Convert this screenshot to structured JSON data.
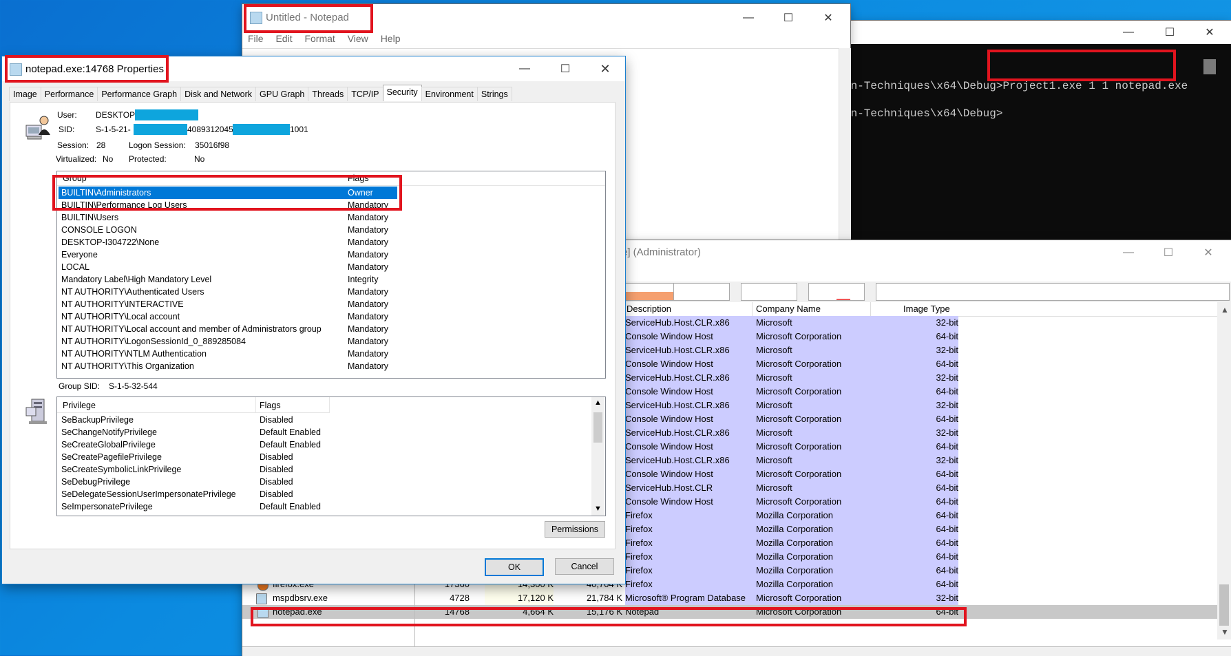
{
  "notepad": {
    "title": "Untitled - Notepad",
    "menu": [
      "File",
      "Edit",
      "Format",
      "View",
      "Help"
    ]
  },
  "console": {
    "line1_prefix": "on-Techniques\\x64\\Debug>",
    "line1_cmd": "Project1.exe 1 1 notepad.exe",
    "line2": "on-Techniques\\x64\\Debug>"
  },
  "procexp": {
    "title": "e] (Administrator)",
    "columns": {
      "description": "Description",
      "company": "Company Name",
      "image_type": "Image Type"
    },
    "rows": [
      {
        "desc": "ServiceHub.Host.CLR.x86",
        "company": "Microsoft",
        "type": "32-bit"
      },
      {
        "desc": "Console Window Host",
        "company": "Microsoft Corporation",
        "type": "64-bit"
      },
      {
        "desc": "ServiceHub.Host.CLR.x86",
        "company": "Microsoft",
        "type": "32-bit"
      },
      {
        "desc": "Console Window Host",
        "company": "Microsoft Corporation",
        "type": "64-bit"
      },
      {
        "desc": "ServiceHub.Host.CLR.x86",
        "company": "Microsoft",
        "type": "32-bit"
      },
      {
        "desc": "Console Window Host",
        "company": "Microsoft Corporation",
        "type": "64-bit"
      },
      {
        "desc": "ServiceHub.Host.CLR.x86",
        "company": "Microsoft",
        "type": "32-bit"
      },
      {
        "desc": "Console Window Host",
        "company": "Microsoft Corporation",
        "type": "64-bit"
      },
      {
        "desc": "ServiceHub.Host.CLR.x86",
        "company": "Microsoft",
        "type": "32-bit"
      },
      {
        "desc": "Console Window Host",
        "company": "Microsoft Corporation",
        "type": "64-bit"
      },
      {
        "desc": "ServiceHub.Host.CLR.x86",
        "company": "Microsoft",
        "type": "32-bit"
      },
      {
        "desc": "Console Window Host",
        "company": "Microsoft Corporation",
        "type": "64-bit"
      },
      {
        "desc": "ServiceHub.Host.CLR",
        "company": "Microsoft",
        "type": "64-bit"
      },
      {
        "desc": "Console Window Host",
        "company": "Microsoft Corporation",
        "type": "64-bit"
      },
      {
        "desc": "Firefox",
        "company": "Mozilla Corporation",
        "type": "64-bit"
      },
      {
        "desc": "Firefox",
        "company": "Mozilla Corporation",
        "type": "64-bit"
      },
      {
        "desc": "Firefox",
        "company": "Mozilla Corporation",
        "type": "64-bit"
      },
      {
        "desc": "Firefox",
        "company": "Mozilla Corporation",
        "type": "64-bit"
      },
      {
        "desc": "Firefox",
        "company": "Mozilla Corporation",
        "type": "64-bit"
      }
    ],
    "process_rows": [
      {
        "name": "firefox.exe",
        "pid": "17360",
        "private": "14,300 K",
        "working": "40,704 K",
        "desc": "Firefox",
        "company": "Mozilla Corporation",
        "type": "64-bit"
      },
      {
        "name": "mspdbsrv.exe",
        "pid": "4728",
        "private": "17,120 K",
        "working": "21,784 K",
        "desc": "Microsoft® Program Database",
        "company": "Microsoft Corporation",
        "type": "32-bit"
      },
      {
        "name": "notepad.exe",
        "pid": "14768",
        "private": "4,664 K",
        "working": "15,176 K",
        "desc": "Notepad",
        "company": "Microsoft Corporation",
        "type": "64-bit"
      }
    ]
  },
  "props": {
    "title": "notepad.exe:14768 Properties",
    "tabs": [
      "Image",
      "Performance",
      "Performance Graph",
      "Disk and Network",
      "GPU Graph",
      "Threads",
      "TCP/IP",
      "Security",
      "Environment",
      "Strings"
    ],
    "user_label": "User:",
    "user_value": "DESKTOP-",
    "sid_label": "SID:",
    "sid_part1": "S-1-5-21-",
    "sid_part2": "4089312045",
    "sid_part3": "1001",
    "session_label": "Session:",
    "session_value": "28",
    "logon_label": "Logon Session:",
    "logon_value": "35016f98",
    "virtualized_label": "Virtualized:",
    "virtualized_value": "No",
    "protected_label": "Protected:",
    "protected_value": "No",
    "group_col": "Group",
    "flags_col": "Flags",
    "groups": [
      {
        "name": "BUILTIN\\Administrators",
        "flag": "Owner"
      },
      {
        "name": "BUILTIN\\Performance Log Users",
        "flag": "Mandatory"
      },
      {
        "name": "BUILTIN\\Users",
        "flag": "Mandatory"
      },
      {
        "name": "CONSOLE LOGON",
        "flag": "Mandatory"
      },
      {
        "name": "DESKTOP-I304722\\None",
        "flag": "Mandatory"
      },
      {
        "name": "Everyone",
        "flag": "Mandatory"
      },
      {
        "name": "LOCAL",
        "flag": "Mandatory"
      },
      {
        "name": "Mandatory Label\\High Mandatory Level",
        "flag": "Integrity"
      },
      {
        "name": "NT AUTHORITY\\Authenticated Users",
        "flag": "Mandatory"
      },
      {
        "name": "NT AUTHORITY\\INTERACTIVE",
        "flag": "Mandatory"
      },
      {
        "name": "NT AUTHORITY\\Local account",
        "flag": "Mandatory"
      },
      {
        "name": "NT AUTHORITY\\Local account and member of Administrators group",
        "flag": "Mandatory"
      },
      {
        "name": "NT AUTHORITY\\LogonSessionId_0_889285084",
        "flag": "Mandatory"
      },
      {
        "name": "NT AUTHORITY\\NTLM Authentication",
        "flag": "Mandatory"
      },
      {
        "name": "NT AUTHORITY\\This Organization",
        "flag": "Mandatory"
      }
    ],
    "group_sid_label": "Group SID:",
    "group_sid_value": "S-1-5-32-544",
    "priv_col": "Privilege",
    "priv_flags_col": "Flags",
    "privileges": [
      {
        "name": "SeBackupPrivilege",
        "flag": "Disabled"
      },
      {
        "name": "SeChangeNotifyPrivilege",
        "flag": "Default Enabled"
      },
      {
        "name": "SeCreateGlobalPrivilege",
        "flag": "Default Enabled"
      },
      {
        "name": "SeCreatePagefilePrivilege",
        "flag": "Disabled"
      },
      {
        "name": "SeCreateSymbolicLinkPrivilege",
        "flag": "Disabled"
      },
      {
        "name": "SeDebugPrivilege",
        "flag": "Disabled"
      },
      {
        "name": "SeDelegateSessionUserImpersonatePrivilege",
        "flag": "Disabled"
      },
      {
        "name": "SeImpersonatePrivilege",
        "flag": "Default Enabled"
      }
    ],
    "permissions_label": "Permissions",
    "ok_label": "OK",
    "cancel_label": "Cancel"
  },
  "colors": {
    "highlight_red": "#e1141e",
    "selection": "#0078d7",
    "procexp_row": "#ccccff",
    "redaction": "#0ea5dd"
  }
}
